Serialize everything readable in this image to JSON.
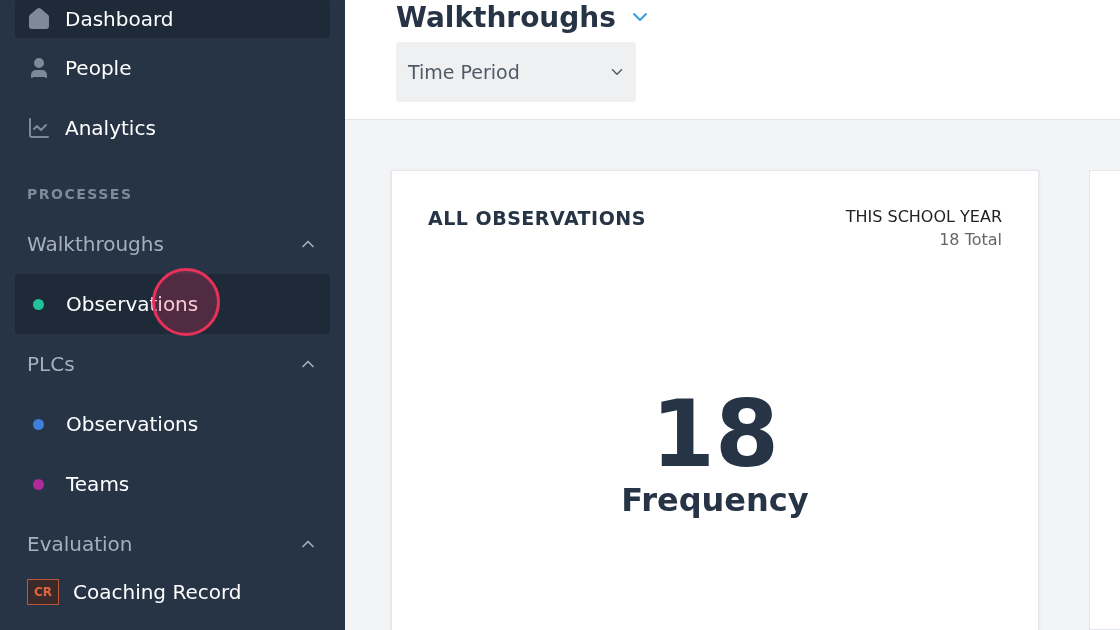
{
  "sidebar": {
    "nav_items": [
      {
        "label": "Dashboard",
        "selected": true
      },
      {
        "label": "People",
        "selected": false
      },
      {
        "label": "Analytics",
        "selected": false
      }
    ],
    "section_label": "PROCESSES",
    "groups": [
      {
        "title": "Walkthroughs",
        "expanded": true,
        "items": [
          {
            "kind": "dot",
            "label": "Observations",
            "color": "#1fc29a",
            "selected": true,
            "clicked": true
          }
        ]
      },
      {
        "title": "PLCs",
        "expanded": true,
        "items": [
          {
            "kind": "dot",
            "label": "Observations",
            "color": "#3d7fd9",
            "selected": false,
            "clicked": false
          },
          {
            "kind": "dot",
            "label": "Teams",
            "color": "#b02a9a",
            "selected": false,
            "clicked": false
          }
        ]
      },
      {
        "title": "Evaluation",
        "expanded": true,
        "items": [
          {
            "kind": "badge",
            "badge": "CR",
            "label": "Coaching Record",
            "selected": false,
            "clicked": false
          }
        ]
      }
    ]
  },
  "header": {
    "title": "Walkthroughs",
    "filter": {
      "value": "Time Period"
    }
  },
  "cards": [
    {
      "title": "ALL OBSERVATIONS",
      "period": "THIS SCHOOL YEAR",
      "total": "18 Total",
      "value": "18",
      "value_label": "Frequency"
    }
  ]
}
